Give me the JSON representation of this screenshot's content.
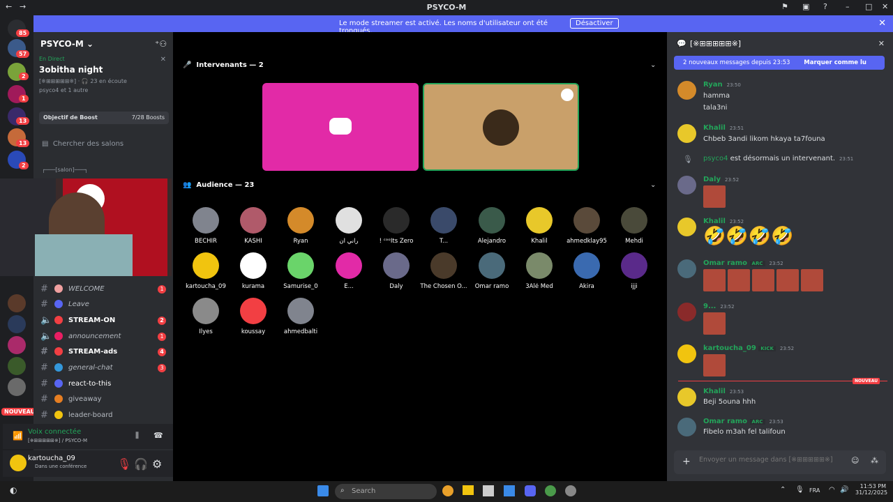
{
  "window": {
    "title": "PSYCO-M"
  },
  "banner": {
    "message": "Le mode streamer est activé. Les noms d'utilisateur ont été tronqués.",
    "button": "Désactiver"
  },
  "guilds": [
    {
      "badge": "85"
    },
    {
      "badge": "57"
    },
    {
      "badge": "2"
    },
    {
      "badge": "1"
    },
    {
      "badge": "13"
    },
    {
      "badge": "13"
    },
    {
      "badge": "2"
    }
  ],
  "server": {
    "name": "PSYCO-M",
    "event": {
      "status": "En Direct",
      "title": "3obitha night",
      "channel": "[※⊞⊞⊞⊞⊞※]",
      "listeners": "23 en écoute",
      "participants": "psyco4 et 1 autre"
    },
    "boost": {
      "label": "Objectif de Boost",
      "count": "7/28 Boosts"
    },
    "search": "Chercher des salons",
    "category": "┌───[salon]───┐",
    "channels": [
      {
        "name": "WELCOME",
        "badge": "1",
        "color": "#f23f43"
      },
      {
        "name": "Leave",
        "badge": "",
        "color": "#5865f2"
      },
      {
        "name": "STREAM-ON",
        "badge": "2",
        "color": "#f23f43"
      },
      {
        "name": "announcement",
        "badge": "1",
        "color": "#e91e63"
      },
      {
        "name": "STREAM-ads",
        "badge": "4",
        "color": "#f23f43"
      },
      {
        "name": "general-chat",
        "badge": "3",
        "color": "#3498db"
      },
      {
        "name": "react-to-this",
        "badge": "",
        "color": "#5865f2"
      },
      {
        "name": "giveaway",
        "badge": "",
        "color": "#e67e22"
      },
      {
        "name": "leader-board",
        "badge": "",
        "color": "#f1c40f"
      }
    ],
    "new_label": "NOUVEAU"
  },
  "voice": {
    "status": "Voix connectée",
    "channel": "[※⊞⊞⊞⊞⊞※] / PSYCO-M"
  },
  "user": {
    "name": "kartoucha_09",
    "status": "Dans une conférence"
  },
  "stage": {
    "speakers_header": "Intervenants — 2",
    "audience_header": "Audience — 23",
    "audience": [
      [
        "BECHIR",
        "KASHI",
        "Ryan",
        "راني ان",
        "! ᶜᵒᵒIts Zero",
        "T...",
        "Alejandro",
        "Khalil",
        "ahmedklay95",
        "Mehdi"
      ],
      [
        "kartoucha_09",
        "kurama",
        "Samurise_0",
        "E...",
        "Daly",
        "The Chosen O...",
        "Omar ramo",
        "3Alé Med",
        "Akira",
        "ijji"
      ],
      [
        "Ilyes",
        "koussay",
        "ahmedbalti"
      ]
    ]
  },
  "chat": {
    "channel": "[※⊞⊞⊞⊞⊞※]",
    "new_messages": "2 nouveaux messages depuis 23:53",
    "mark_read": "Marquer comme lu",
    "messages": [
      {
        "user": "Ryan",
        "time": "23:50",
        "lines": [
          "hamma",
          "tala3ni"
        ]
      },
      {
        "user": "Khalil",
        "time": "23:51",
        "lines": [
          "Chbeb 3andi likom hkaya ta7founa"
        ]
      },
      {
        "user": "psyco4",
        "time": "23:51",
        "system": "est désormais un intervenant."
      },
      {
        "user": "Daly",
        "time": "23:52"
      },
      {
        "user": "Khalil",
        "time": "23:52"
      },
      {
        "user": "Omar ramo",
        "tag": "ARC",
        "time": "23:52"
      },
      {
        "user": "9...",
        "time": "23:52"
      },
      {
        "user": "kartoucha_09",
        "tag": "KICK",
        "time": "23:52"
      },
      {
        "user": "Khalil",
        "time": "23:53",
        "lines": [
          "Beji 5ouna hhh"
        ]
      },
      {
        "user": "Omar ramo",
        "tag": "ARC",
        "time": "23:53",
        "lines": [
          "Fibelo m3ah fel talifoun"
        ]
      }
    ],
    "divider": "NOUVEAU",
    "placeholder": "Envoyer un message dans [※⊞⊞⊞⊞⊞※]"
  },
  "taskbar": {
    "search": "Search",
    "lang": "FRA",
    "time": "11:53 PM",
    "date": "31/12/2025"
  }
}
